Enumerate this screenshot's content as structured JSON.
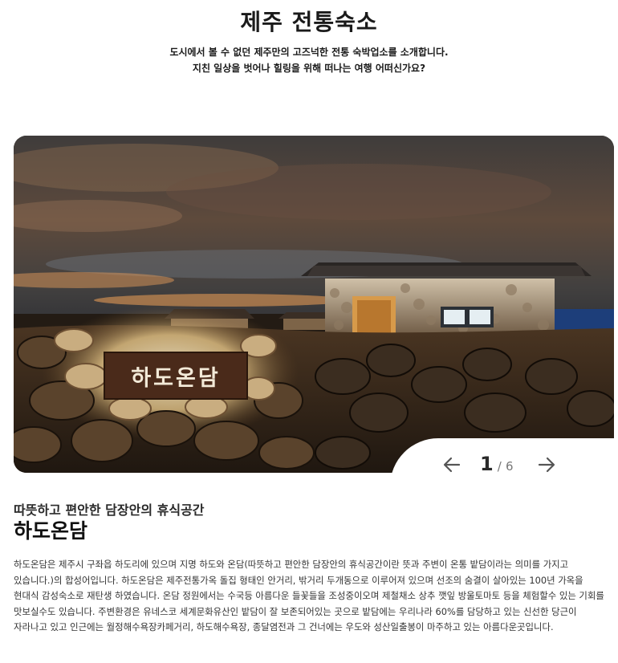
{
  "header": {
    "title": "제주 전통숙소",
    "intro_line1": "도시에서 볼 수 없던 제주만의 고즈넉한 전통 숙박업소를 소개합니다.",
    "intro_line2": "지친 일상을 벗어나 힐링을 위해 떠나는 여행 어떠신가요?"
  },
  "carousel": {
    "sign_text": "하도온담",
    "current": "1",
    "separator": "/",
    "total": "6",
    "prev_icon": "arrow-left-icon",
    "next_icon": "arrow-right-icon"
  },
  "listing": {
    "subtitle": "따뜻하고 편안한 담장안의 휴식공간",
    "name": "하도온담",
    "description": "하도온담은 제주시 구좌읍 하도리에 있으며 지명 하도와 온담(따뜻하고 편안한 담장안의 휴식공간이란 뜻과 주변이 온통 밭담이라는 의미를 가지고 있습니다.)의 합성어입니다. 하도온담은 제주전통가옥 돌집 형태인 안거리, 밖거리 두개동으로 이루어져 있으며 선조의 숨결이 살아있는 100년 가옥을 현대식 감성숙소로 재탄생 하였습니다. 온담 정원에서는 수국등 아름다운 들꽃들을 조성중이오며 제철채소 상추 깻잎 방울토마토 등을 체험할수 있는 기회를 맛보실수도 있습니다. 주변환경은 유네스코 세계문화유산인 밭담이 잘 보존되어있는 곳으로 밭담에는 우리나라 60%를 담당하고 있는 신선한 당근이 자라나고 있고 인근에는 월정해수욕장카페거리, 하도해수욕장, 종달염전과 그 건너에는 우도와 성산일출봉이 마주하고 있는 아름다운곳입니다."
  }
}
